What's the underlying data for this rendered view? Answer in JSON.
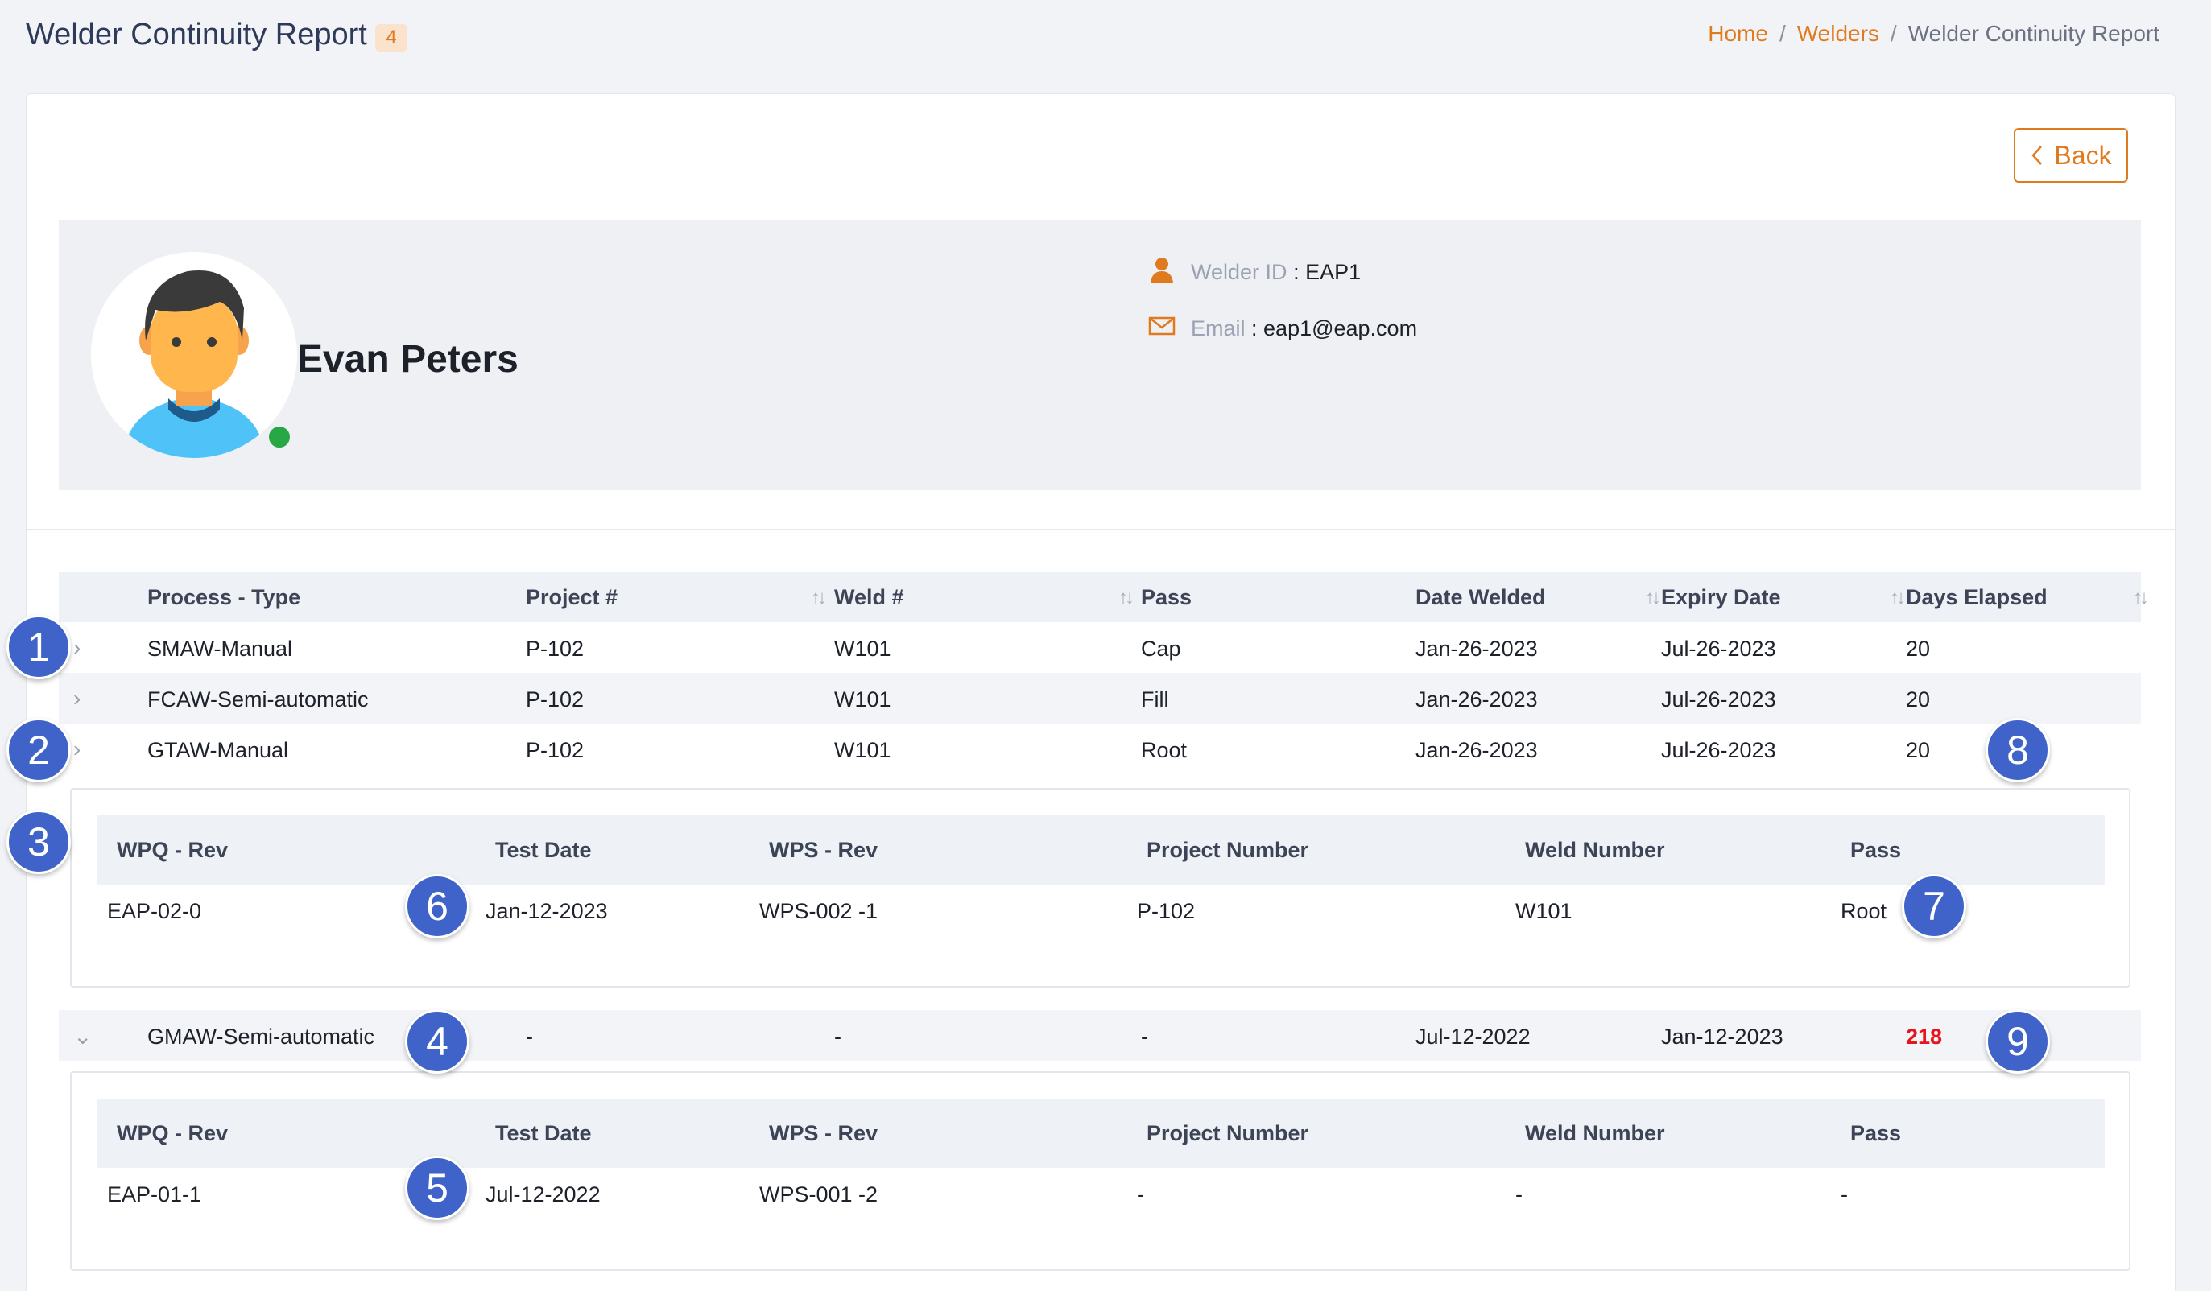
{
  "header": {
    "title": "Welder Continuity Report",
    "count": "4",
    "breadcrumb": {
      "home": "Home",
      "welders": "Welders",
      "current": "Welder Continuity Report",
      "sep": "/"
    }
  },
  "back_label": "Back",
  "profile": {
    "name": "Evan Peters",
    "welder_id_label": "Welder ID",
    "welder_id": ": EAP1",
    "email_label": "Email",
    "email": ": eap1@eap.com"
  },
  "table": {
    "columns": [
      "Process - Type",
      "Project #",
      "Weld #",
      "Pass",
      "Date Welded",
      "Expiry Date",
      "Days Elapsed"
    ],
    "rows": [
      {
        "process": "SMAW-Manual",
        "project": "P-102",
        "weld": "W101",
        "pass": "Cap",
        "date_welded": "Jan-26-2023",
        "expiry": "Jul-26-2023",
        "days": "20"
      },
      {
        "process": "FCAW-Semi-automatic",
        "project": "P-102",
        "weld": "W101",
        "pass": "Fill",
        "date_welded": "Jan-26-2023",
        "expiry": "Jul-26-2023",
        "days": "20"
      },
      {
        "process": "GTAW-Manual",
        "project": "P-102",
        "weld": "W101",
        "pass": "Root",
        "date_welded": "Jan-26-2023",
        "expiry": "Jul-26-2023",
        "days": "20"
      },
      {
        "process": "GMAW-Semi-automatic",
        "project": "-",
        "weld": "-",
        "pass": "-",
        "date_welded": "Jul-12-2022",
        "expiry": "Jan-12-2023",
        "days": "218"
      }
    ]
  },
  "sub_tables": {
    "columns": [
      "WPQ - Rev",
      "Test Date",
      "WPS - Rev",
      "Project Number",
      "Weld Number",
      "Pass"
    ],
    "gtaw": {
      "wpq": "EAP-02-0",
      "test_date": "Jan-12-2023",
      "wps": "WPS-002 -1",
      "project": "P-102",
      "weld": "W101",
      "pass": "Root"
    },
    "gmaw": {
      "wpq": "EAP-01-1",
      "test_date": "Jul-12-2022",
      "wps": "WPS-001 -2",
      "project": "-",
      "weld": "-",
      "pass": "-"
    }
  },
  "badges": [
    "1",
    "2",
    "3",
    "4",
    "5",
    "6",
    "7",
    "8",
    "9"
  ],
  "colors": {
    "accent": "#e07a1f",
    "badge": "#3f63c8",
    "alert": "#e8141b",
    "online": "#28a745"
  }
}
